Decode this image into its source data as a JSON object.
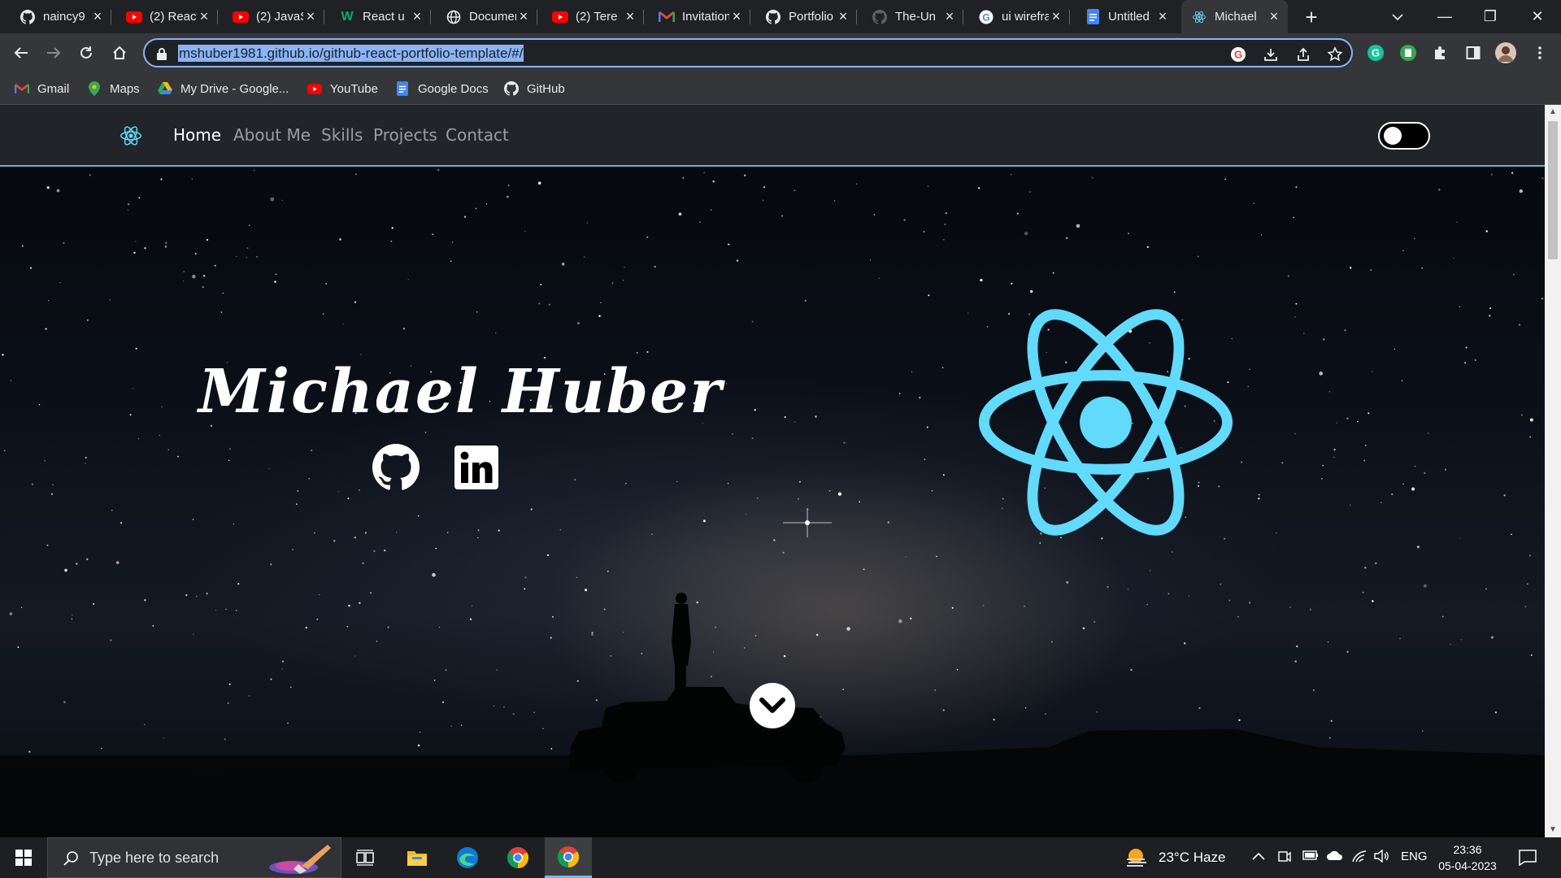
{
  "browser": {
    "tabs": [
      {
        "title": "naincy9",
        "icon": "github-icon"
      },
      {
        "title": "(2) React",
        "icon": "youtube-icon"
      },
      {
        "title": "(2) JavaScript",
        "icon": "youtube-icon"
      },
      {
        "title": "React u",
        "icon": "w3schools-icon"
      },
      {
        "title": "Document",
        "icon": "globe-icon"
      },
      {
        "title": "(2) Tere",
        "icon": "youtube-icon"
      },
      {
        "title": "Invitation",
        "icon": "gmail-icon"
      },
      {
        "title": "Portfolio",
        "icon": "github-icon"
      },
      {
        "title": "The-Un",
        "icon": "github-icon"
      },
      {
        "title": "ui wireframe",
        "icon": "google-icon"
      },
      {
        "title": "Untitled",
        "icon": "google-docs-icon"
      },
      {
        "title": "Michael",
        "icon": "react-icon"
      }
    ],
    "address": "mshuber1981.github.io/github-react-portfolio-template/#/",
    "bookmarks": [
      {
        "label": "Gmail",
        "icon": "gmail-icon"
      },
      {
        "label": "Maps",
        "icon": "maps-icon"
      },
      {
        "label": "My Drive - Google...",
        "icon": "drive-icon"
      },
      {
        "label": "YouTube",
        "icon": "youtube-icon"
      },
      {
        "label": "Google Docs",
        "icon": "google-docs-icon"
      },
      {
        "label": "GitHub",
        "icon": "github-icon"
      }
    ]
  },
  "site": {
    "nav": [
      {
        "label": "Home",
        "active": true
      },
      {
        "label": "About Me",
        "active": false
      },
      {
        "label": "Skills",
        "active": false
      },
      {
        "label": "Projects",
        "active": false
      },
      {
        "label": "Contact",
        "active": false
      }
    ],
    "hero_title": "Michael Huber",
    "social": [
      "github-icon",
      "linkedin-icon"
    ],
    "theme_toggle": "dark",
    "accent": "#61dafb"
  },
  "taskbar": {
    "search_placeholder": "Type here to search",
    "weather": "23°C  Haze",
    "language": "ENG",
    "time": "23:36",
    "date": "05-04-2023"
  }
}
